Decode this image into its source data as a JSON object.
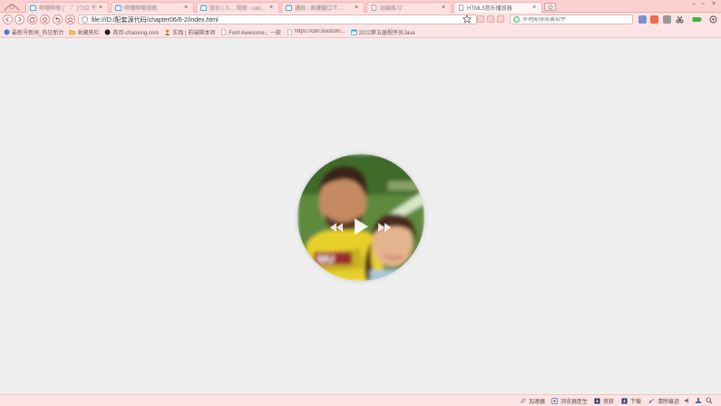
{
  "tabs": [
    {
      "title": "哔哩哔哩 (゜-゜)つロ 干杯~",
      "active": false
    },
    {
      "title": "哔哩哔哩视频",
      "active": false
    },
    {
      "title": "音乐 | 人... 视频 - san...",
      "active": false
    },
    {
      "title": "通知 - 新建窗口下...",
      "active": false
    },
    {
      "title": "动画练习",
      "active": false
    },
    {
      "title": "HTML5音乐播放器",
      "active": true
    }
  ],
  "toolbar": {
    "url": "file:///D:/配套源代码/chapter06/6-2/index.html",
    "search_placeholder": "多地能够效果软件"
  },
  "bookmarks": [
    {
      "label": "最新号新闻_热见新台",
      "icon": "globe-icon"
    },
    {
      "label": "收藏夹栏",
      "icon": "folder-icon"
    },
    {
      "label": "首页-chaoxing.com",
      "icon": "circle-icon"
    },
    {
      "label": "实践 | 前端脚本项",
      "icon": "person-icon"
    },
    {
      "label": "Font Awesome，一款",
      "icon": "page-icon"
    },
    {
      "label": "https://cdn.bootcdn...",
      "icon": "page-icon"
    },
    {
      "label": "2022第五届程序员Java",
      "icon": "calendar-icon"
    }
  ],
  "player": {
    "prev_icon": "backward-icon",
    "play_icon": "play-icon",
    "next_icon": "forward-icon"
  },
  "statusbar": {
    "items": [
      "加速器",
      "浏览器医生",
      "资获",
      "下载"
    ],
    "last": "清除痕迹"
  },
  "colors": {
    "chrome": "#fde4e4",
    "tabbar": "#fbd0d0",
    "page_bg": "#efefef"
  }
}
